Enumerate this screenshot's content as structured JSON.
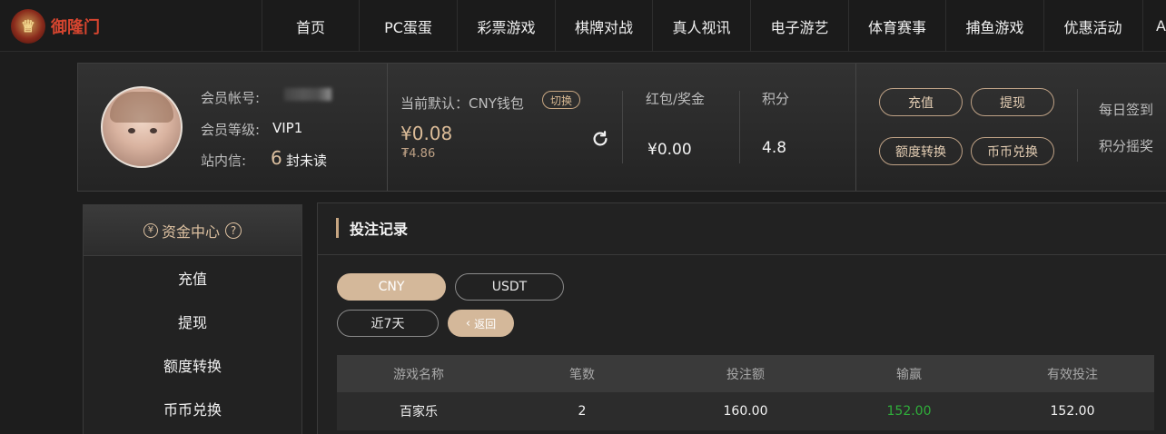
{
  "brand": {
    "logo_text": "御隆门"
  },
  "nav": {
    "items": [
      "首页",
      "PC蛋蛋",
      "彩票游戏",
      "棋牌对战",
      "真人视讯",
      "电子游艺",
      "体育赛事",
      "捕鱼游戏",
      "优惠活动"
    ],
    "more": "A"
  },
  "member": {
    "account_label": "会员帐号:",
    "level_label": "会员等级:",
    "level_value": "VIP1",
    "inbox_label": "站内信:",
    "inbox_count": "6",
    "inbox_suffix": "封未读",
    "wallet_label": "当前默认：CNY钱包",
    "switch_label": "切换",
    "balance": "¥0.08",
    "balance_sub": "₮4.86",
    "bonus_label": "红包/奖金",
    "bonus_value": "¥0.00",
    "points_label": "积分",
    "points_value": "4.8",
    "buttons": [
      "充值",
      "提现",
      "额度转换",
      "币币兑换"
    ],
    "daily_checkin": "每日签到",
    "points_shake": "积分摇奖"
  },
  "sidebar": {
    "title": "资金中心",
    "help": "?",
    "items": [
      "充值",
      "提现",
      "额度转换",
      "币币兑换"
    ]
  },
  "main": {
    "title": "投注记录",
    "currency_tabs": [
      "CNY",
      "USDT"
    ],
    "range_tab": "近7天",
    "back_label": "返回",
    "table": {
      "headers": [
        "游戏名称",
        "笔数",
        "投注额",
        "输赢",
        "有效投注"
      ],
      "rows": [
        [
          "百家乐",
          "2",
          "160.00",
          "152.00",
          "152.00"
        ]
      ]
    }
  },
  "colors": {
    "accent": "#d4b89a",
    "win_green": "#2fae3a",
    "background": "#1d1d1d"
  }
}
